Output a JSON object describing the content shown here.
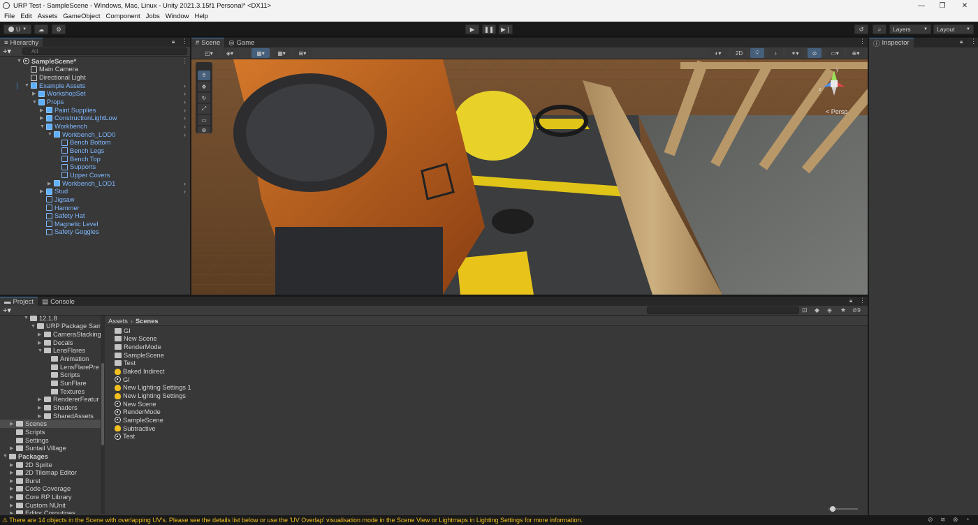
{
  "window": {
    "title": "URP Test - SampleScene - Windows, Mac, Linux - Unity 2021.3.15f1 Personal* <DX11>"
  },
  "menu": [
    "File",
    "Edit",
    "Assets",
    "GameObject",
    "Component",
    "Jobs",
    "Window",
    "Help"
  ],
  "toolbar": {
    "account": "U",
    "layers": "Layers",
    "layout": "Layout"
  },
  "hierarchy": {
    "tab": "Hierarchy",
    "search_placeholder": "All",
    "items": [
      {
        "label": "SampleScene*",
        "depth": 0,
        "type": "scene",
        "caret": "▼"
      },
      {
        "label": "Main Camera",
        "depth": 1,
        "type": "g",
        "caret": ""
      },
      {
        "label": "Directional Light",
        "depth": 1,
        "type": "g",
        "caret": ""
      },
      {
        "label": "Example Assets",
        "depth": 1,
        "type": "b",
        "caret": "▼"
      },
      {
        "label": "WorkshopSet",
        "depth": 2,
        "type": "b",
        "caret": "▶"
      },
      {
        "label": "Props",
        "depth": 2,
        "type": "b",
        "caret": "▼"
      },
      {
        "label": "Paint Supplies",
        "depth": 3,
        "type": "b",
        "caret": "▶"
      },
      {
        "label": "ConstructionLightLow",
        "depth": 3,
        "type": "b",
        "caret": "▶"
      },
      {
        "label": "Workbench",
        "depth": 3,
        "type": "b",
        "caret": "▼"
      },
      {
        "label": "Workbench_LOD0",
        "depth": 4,
        "type": "b",
        "caret": "▼"
      },
      {
        "label": "Bench Bottom",
        "depth": 5,
        "type": "bo",
        "caret": ""
      },
      {
        "label": "Bench Legs",
        "depth": 5,
        "type": "bo",
        "caret": ""
      },
      {
        "label": "Bench Top",
        "depth": 5,
        "type": "bo",
        "caret": ""
      },
      {
        "label": "Supports",
        "depth": 5,
        "type": "bo",
        "caret": ""
      },
      {
        "label": "Upper Covers",
        "depth": 5,
        "type": "bo",
        "caret": ""
      },
      {
        "label": "Workbench_LOD1",
        "depth": 4,
        "type": "b",
        "caret": "▶"
      },
      {
        "label": "Stud",
        "depth": 3,
        "type": "b",
        "caret": "▶"
      },
      {
        "label": "Jigsaw",
        "depth": 3,
        "type": "bo",
        "caret": ""
      },
      {
        "label": "Hammer",
        "depth": 3,
        "type": "bo",
        "caret": ""
      },
      {
        "label": "Safety Hat",
        "depth": 3,
        "type": "bo",
        "caret": ""
      },
      {
        "label": "Magnetic Level",
        "depth": 3,
        "type": "bo",
        "caret": ""
      },
      {
        "label": "Safety Goggles",
        "depth": 3,
        "type": "bo",
        "caret": ""
      }
    ]
  },
  "scene": {
    "tab_scene": "Scene",
    "tab_game": "Game",
    "mode_2d": "2D",
    "persp": "< Persp",
    "gizmo_y": "y",
    "gizmo_z": "z"
  },
  "inspector": {
    "tab": "Inspector"
  },
  "project": {
    "tab_project": "Project",
    "tab_console": "Console",
    "hidden_count": "9",
    "breadcrumb_root": "Assets",
    "breadcrumb_current": "Scenes",
    "tree": [
      {
        "label": "12.1.8",
        "depth": 3,
        "caret": "▼"
      },
      {
        "label": "URP Package Sam",
        "depth": 4,
        "caret": "▼"
      },
      {
        "label": "CameraStacking",
        "depth": 5,
        "caret": "▶"
      },
      {
        "label": "Decals",
        "depth": 5,
        "caret": "▶"
      },
      {
        "label": "LensFlares",
        "depth": 5,
        "caret": "▼"
      },
      {
        "label": "Animation",
        "depth": 6,
        "caret": ""
      },
      {
        "label": "LensFlarePre",
        "depth": 6,
        "caret": ""
      },
      {
        "label": "Scripts",
        "depth": 6,
        "caret": ""
      },
      {
        "label": "SunFlare",
        "depth": 6,
        "caret": ""
      },
      {
        "label": "Textures",
        "depth": 6,
        "caret": ""
      },
      {
        "label": "RendererFeatur",
        "depth": 5,
        "caret": "▶"
      },
      {
        "label": "Shaders",
        "depth": 5,
        "caret": "▶"
      },
      {
        "label": "SharedAssets",
        "depth": 5,
        "caret": "▶"
      },
      {
        "label": "Scenes",
        "depth": 1,
        "caret": "▶",
        "selected": true
      },
      {
        "label": "Scripts",
        "depth": 1,
        "caret": ""
      },
      {
        "label": "Settings",
        "depth": 1,
        "caret": ""
      },
      {
        "label": "Suntail Village",
        "depth": 1,
        "caret": "▶"
      },
      {
        "label": "Packages",
        "depth": 0,
        "caret": "▼",
        "bold": true
      },
      {
        "label": "2D Sprite",
        "depth": 1,
        "caret": "▶"
      },
      {
        "label": "2D Tilemap Editor",
        "depth": 1,
        "caret": "▶"
      },
      {
        "label": "Burst",
        "depth": 1,
        "caret": "▶"
      },
      {
        "label": "Code Coverage",
        "depth": 1,
        "caret": "▶"
      },
      {
        "label": "Core RP Library",
        "depth": 1,
        "caret": "▶"
      },
      {
        "label": "Custom NUnit",
        "depth": 1,
        "caret": "▶"
      },
      {
        "label": "Editor Coroutines",
        "depth": 1,
        "caret": "▶"
      }
    ],
    "files": [
      {
        "label": "GI",
        "icon": "folder"
      },
      {
        "label": "New Scene",
        "icon": "folder"
      },
      {
        "label": "RenderMode",
        "icon": "folder"
      },
      {
        "label": "SampleScene",
        "icon": "folder"
      },
      {
        "label": "Test",
        "icon": "folder"
      },
      {
        "label": "Baked Indirect",
        "icon": "bulb"
      },
      {
        "label": "GI",
        "icon": "unity"
      },
      {
        "label": "New Lighting Settings 1",
        "icon": "bulb"
      },
      {
        "label": "New Lighting Settings",
        "icon": "bulb"
      },
      {
        "label": "New Scene",
        "icon": "unity"
      },
      {
        "label": "RenderMode",
        "icon": "unity"
      },
      {
        "label": "SampleScene",
        "icon": "unity"
      },
      {
        "label": "Subtractive",
        "icon": "bulb"
      },
      {
        "label": "Test",
        "icon": "unity"
      }
    ]
  },
  "status": {
    "message": "There are 14 objects in the Scene with overlapping UV's. Please see the details list below or use the 'UV Overlap' visualisation mode in the Scene View or Lightmaps in Lighting Settings for more information."
  },
  "colors": {
    "accent": "#3a79bb",
    "selected_text": "#7fb8ff",
    "warning": "#f0c020"
  }
}
